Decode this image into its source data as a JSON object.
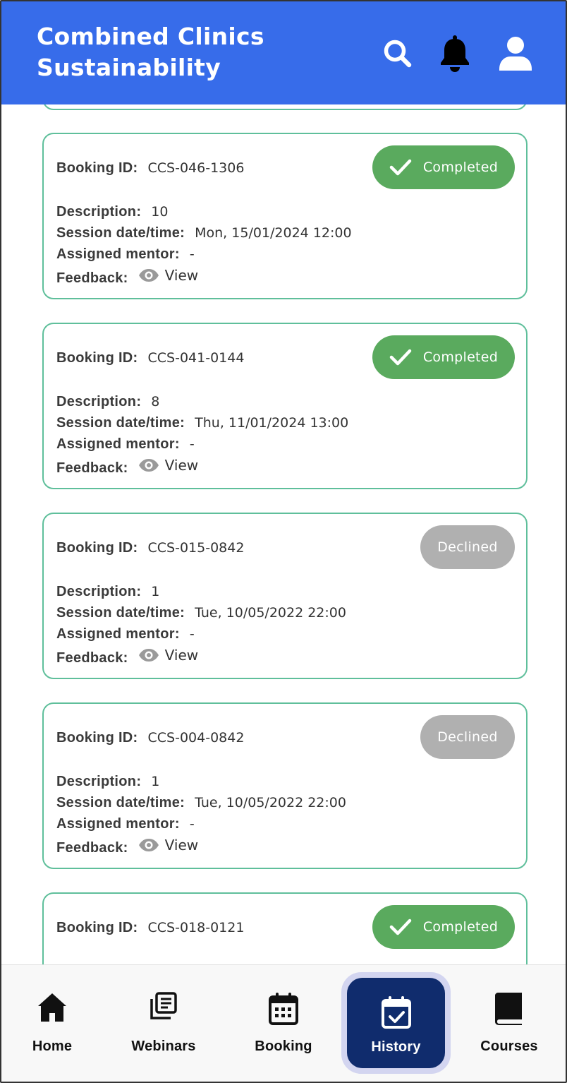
{
  "header": {
    "title_line1": "Combined Clinics",
    "title_line2": "Sustainability",
    "icons": [
      "search-icon",
      "bell-icon",
      "user-icon"
    ],
    "background_color": "#376cea"
  },
  "labels": {
    "booking_id": "Booking ID:",
    "description": "Description:",
    "session": "Session date/time:",
    "mentor": "Assigned mentor:",
    "feedback": "Feedback:",
    "view": "View"
  },
  "bookings": [
    {
      "booking_id": "CCS-046-1306",
      "status": "Completed",
      "description": "10",
      "session": "Mon, 15/01/2024 12:00",
      "mentor": "-"
    },
    {
      "booking_id": "CCS-041-0144",
      "status": "Completed",
      "description": "8",
      "session": "Thu, 11/01/2024 13:00",
      "mentor": "-"
    },
    {
      "booking_id": "CCS-015-0842",
      "status": "Declined",
      "description": "1",
      "session": "Tue, 10/05/2022 22:00",
      "mentor": "-"
    },
    {
      "booking_id": "CCS-004-0842",
      "status": "Declined",
      "description": "1",
      "session": "Tue, 10/05/2022 22:00",
      "mentor": "-"
    },
    {
      "booking_id": "CCS-018-0121",
      "status": "Completed"
    }
  ],
  "status_colors": {
    "completed": "#5aaa5e",
    "declined": "#b0b0b0",
    "card_border": "#5fbf9b"
  },
  "bottom_nav": {
    "items": [
      {
        "label": "Home",
        "icon": "home-icon"
      },
      {
        "label": "Webinars",
        "icon": "webinars-icon"
      },
      {
        "label": "Booking",
        "icon": "calendar-icon"
      },
      {
        "label": "History",
        "icon": "calendar-check-icon",
        "active": true
      },
      {
        "label": "Courses",
        "icon": "book-icon"
      }
    ],
    "active_color": "#102c6d"
  }
}
